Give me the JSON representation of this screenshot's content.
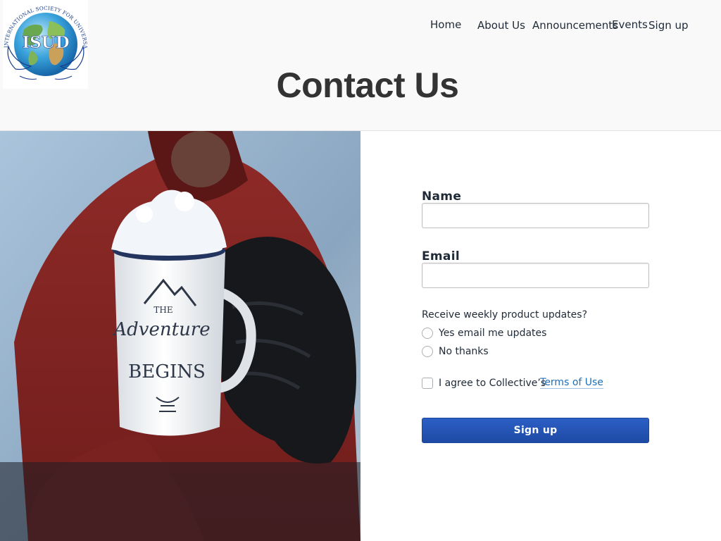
{
  "logo": {
    "org_name": "INTERNATIONAL SOCIETY FOR UNIVERSAL DIALOGUE",
    "acronym": "ISUD"
  },
  "nav": {
    "items": [
      {
        "label": "Home"
      },
      {
        "label": "About Us"
      },
      {
        "label": "Announcements"
      },
      {
        "label": "Events"
      },
      {
        "label": "Sign up"
      }
    ]
  },
  "page": {
    "title": "Contact Us"
  },
  "hero": {
    "mug_line_1": "THE",
    "mug_line_2": "Adventure",
    "mug_line_3": "BEGINS"
  },
  "form": {
    "name_label": "Name",
    "name_value": "",
    "email_label": "Email",
    "email_value": "",
    "updates_question": "Receive weekly product updates?",
    "options": [
      {
        "label": "Yes email me updates",
        "selected": false
      },
      {
        "label": "No thanks",
        "selected": false
      }
    ],
    "terms_text": "I agree to Collective’s",
    "terms_link": "Terms of Use",
    "terms_checked": false,
    "submit_label": "Sign up"
  },
  "colors": {
    "header_bg": "#f9f9f9",
    "button_bg": "#2a57b8",
    "link": "#1d6fb8",
    "title": "#333333"
  },
  "icons": [
    "globe-logo-icon",
    "radio-icon",
    "checkbox-icon"
  ]
}
